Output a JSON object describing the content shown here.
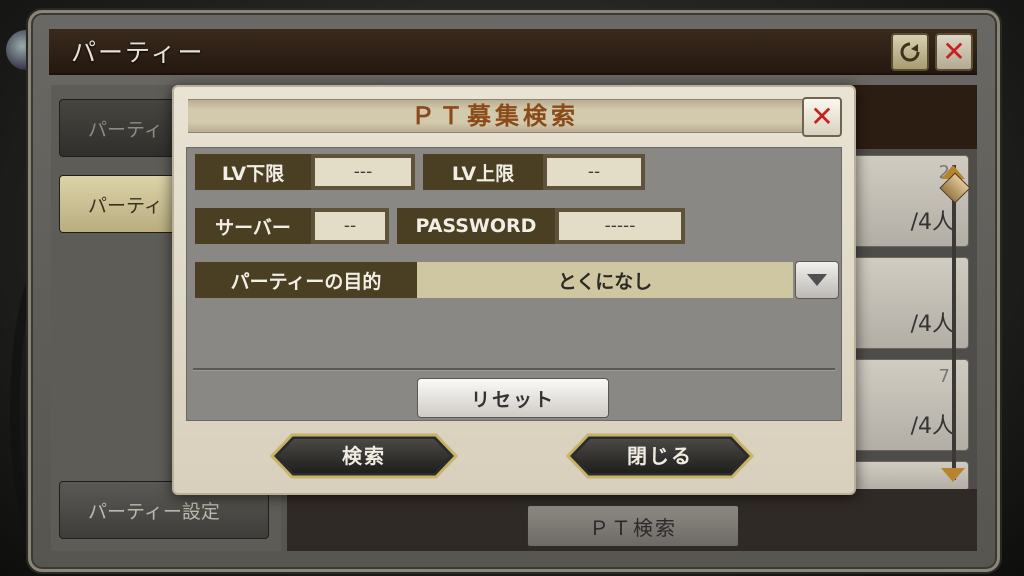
{
  "party_window": {
    "title": "パーティー",
    "side_buttons": [
      "パーティ",
      "パーティ",
      "パーティー設定"
    ],
    "list_items": [
      {
        "num": "2",
        "cap": "/4人"
      },
      {
        "num": "",
        "cap": "/4人"
      },
      {
        "num": "7",
        "cap": "/4人"
      }
    ],
    "pt_search_label": "ＰＴ検索"
  },
  "dialog": {
    "title": "ＰＴ募集検索",
    "fields": {
      "lv_min_label": "LV下限",
      "lv_min_value": "---",
      "lv_max_label": "LV上限",
      "lv_max_value": "--",
      "server_label": "サーバー",
      "server_value": "--",
      "password_label": "PASSWORD",
      "password_value": "-----",
      "purpose_label": "パーティーの目的",
      "purpose_value": "とくになし"
    },
    "reset_label": "リセット",
    "search_label": "検索",
    "close_label": "閉じる"
  },
  "colors": {
    "accent_title": "#8a4a1a",
    "close_x": "#c81f1f",
    "label_bg": "#4a3f22",
    "gold": "#b8832e"
  }
}
